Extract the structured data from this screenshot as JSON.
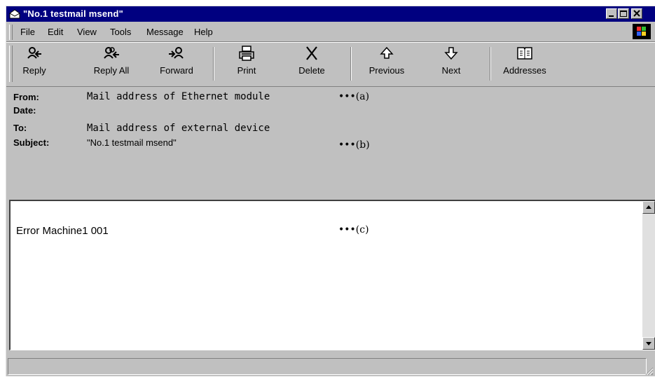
{
  "window": {
    "title": "\"No.1 testmail msend\""
  },
  "menu": [
    "File",
    "Edit",
    "View",
    "Tools",
    "Message",
    "Help"
  ],
  "toolbar": {
    "reply": "Reply",
    "reply_all": "Reply All",
    "forward": "Forward",
    "print": "Print",
    "delete": "Delete",
    "previous": "Previous",
    "next": "Next",
    "addresses": "Addresses"
  },
  "headers": {
    "from_label": "From:",
    "from_value": "Mail address of Ethernet module",
    "date_label": "Date:",
    "to_label": "To:",
    "to_value": "Mail address of external device",
    "subject_label": "Subject:",
    "subject_value": "\"No.1 testmail msend\""
  },
  "annotations": {
    "a": "•••(a)",
    "b": "•••(b)",
    "c": "•••(c)"
  },
  "message": {
    "body": "Error Machine1 001"
  },
  "colors": {
    "titlebar": "#000080",
    "face": "#c0c0c0"
  }
}
